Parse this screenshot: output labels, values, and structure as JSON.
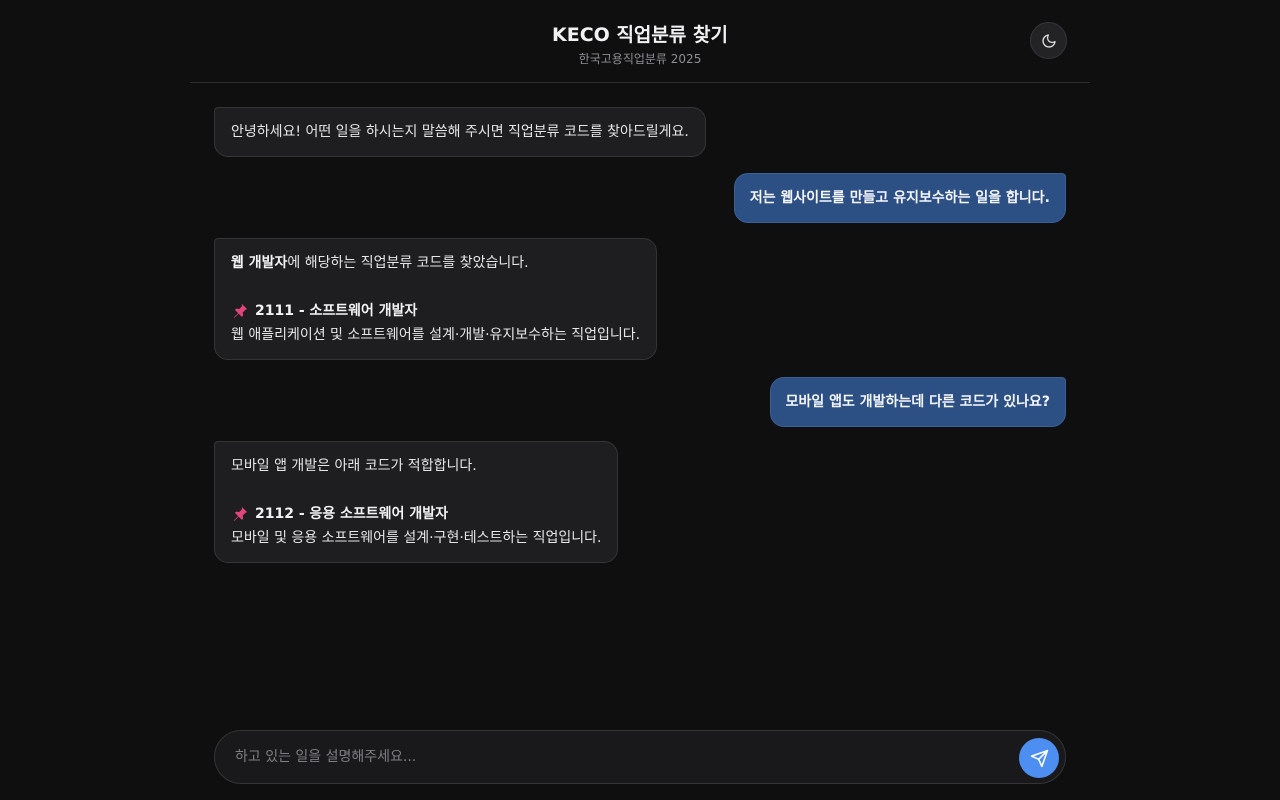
{
  "header": {
    "title": "KECO 직업분류 찾기",
    "subtitle": "한국고용직업분류 2025"
  },
  "icons": {
    "theme_toggle": "moon-icon",
    "pin": "pushpin-icon",
    "send": "paper-plane-icon"
  },
  "colors": {
    "background": "#0f0f10",
    "user_bubble": "#2c4f84",
    "bot_bubble": "#1e1e20",
    "accent": "#4d8ff0",
    "pin": "#e0457b"
  },
  "messages": [
    {
      "role": "bot",
      "text": "안녕하세요! 어떤 일을 하시는지 말씀해 주시면 직업분류 코드를 찾아드릴게요."
    },
    {
      "role": "user",
      "text": "저는 웹사이트를 만들고 유지보수하는 일을 합니다."
    },
    {
      "role": "bot",
      "highlight": "웹 개발자",
      "intro_rest": "에 해당하는 직업분류 코드를 찾았습니다.",
      "code_title": "2111 - 소프트웨어 개발자",
      "code_desc": "웹 애플리케이션 및 소프트웨어를 설계·개발·유지보수하는 직업입니다."
    },
    {
      "role": "user",
      "text": "모바일 앱도 개발하는데 다른 코드가 있나요?"
    },
    {
      "role": "bot",
      "intro": "모바일 앱 개발은 아래 코드가 적합합니다.",
      "code_title": "2112 - 응용 소프트웨어 개발자",
      "code_desc": "모바일 및 응용 소프트웨어를 설계·구현·테스트하는 직업입니다."
    }
  ],
  "composer": {
    "placeholder": "하고 있는 일을 설명해주세요..."
  }
}
